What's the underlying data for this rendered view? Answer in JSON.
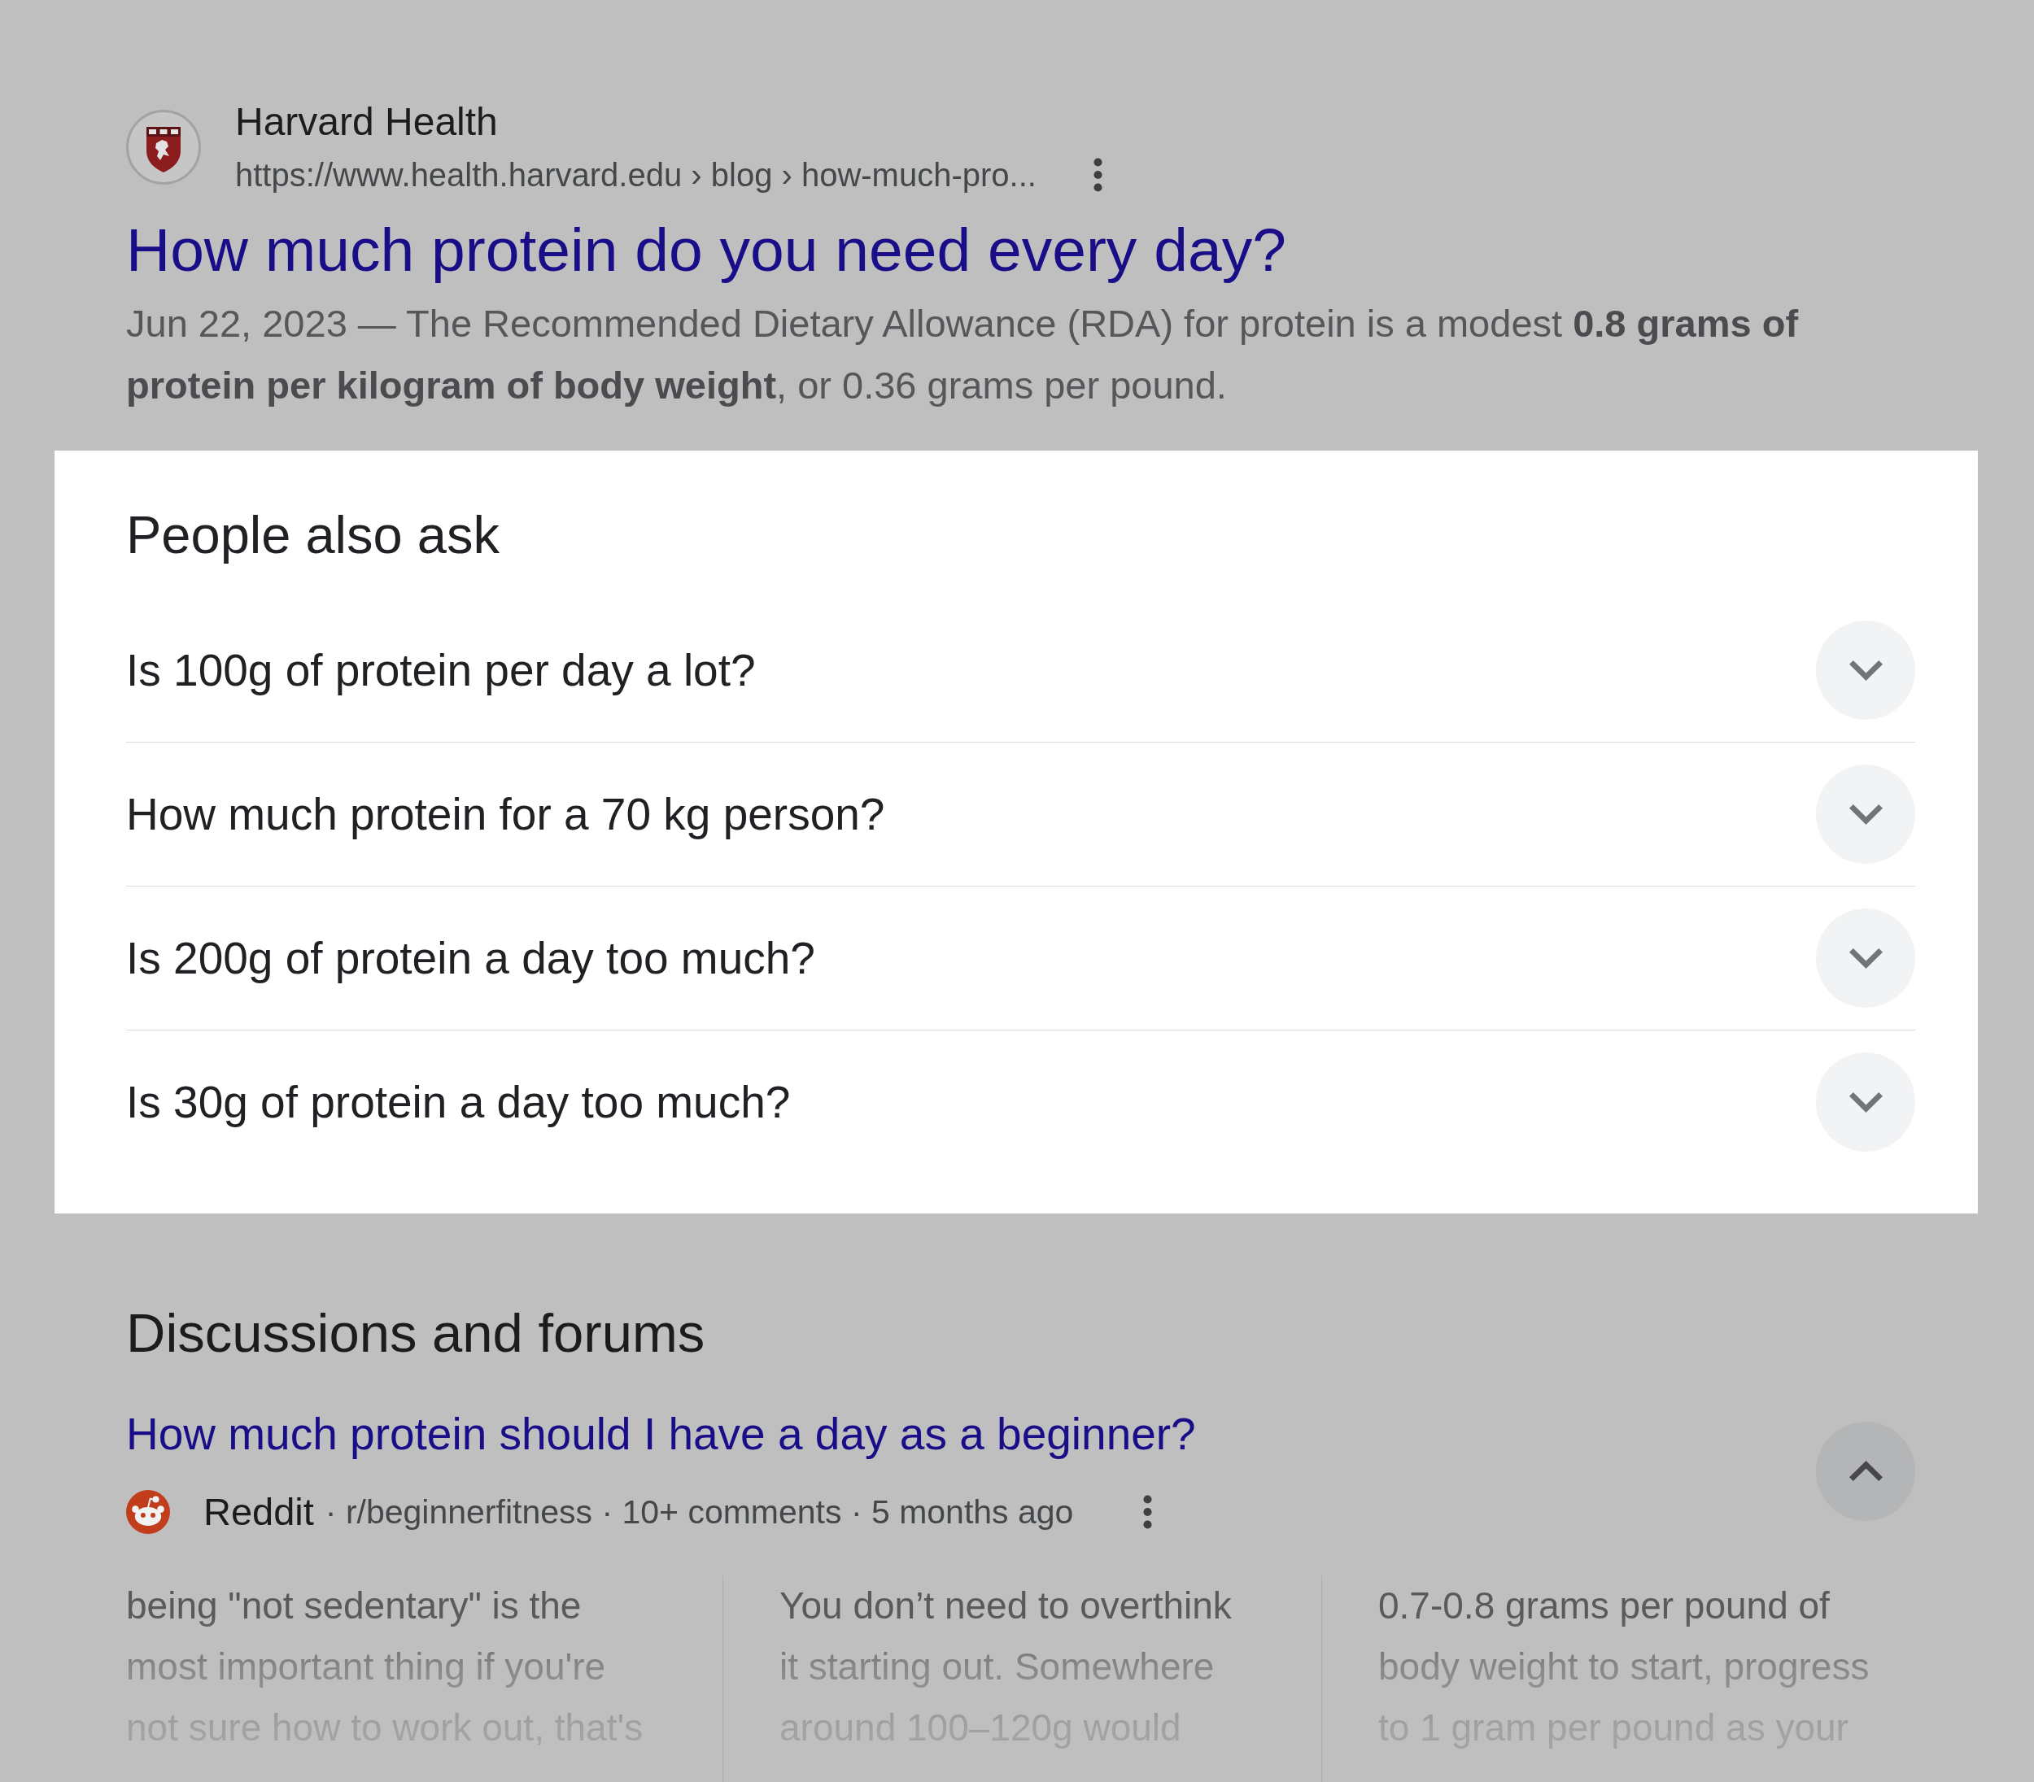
{
  "result": {
    "site_name": "Harvard Health",
    "url": "https://www.health.harvard.edu › blog › how-much-pro...",
    "title": "How much protein do you need every day?",
    "snippet": "Jun 22, 2023 — The Recommended Dietary Allowance (RDA) for protein is a modest **0.8 grams of protein per kilogram of body weight**, or 0.36 grams per pound."
  },
  "people_also_ask": {
    "title": "People also ask",
    "questions": [
      {
        "text": "Is 100g of protein per day a lot?",
        "expanded": false
      },
      {
        "text": "How much protein for a 70 kg person?",
        "expanded": false
      },
      {
        "text": "Is 200g of protein a day too much?",
        "expanded": false
      },
      {
        "text": "Is 30g of protein a day too much?",
        "expanded": false
      }
    ]
  },
  "discussions": {
    "title": "Discussions and forums",
    "threads": [
      {
        "title": "How much protein should I have a day as a beginner?",
        "source": "Reddit",
        "info": "· r/beginnerfitness · 10+ comments · 5 months ago",
        "expanded": true,
        "snippets": [
          "being \"not sedentary\" is the most important thing if you're not sure how to work out, that's",
          "You don’t need to overthink it starting out. Somewhere around 100–120g would",
          "0.7-0.8 grams per pound of body weight to start, progress to 1 gram per pound as your"
        ]
      }
    ]
  }
}
